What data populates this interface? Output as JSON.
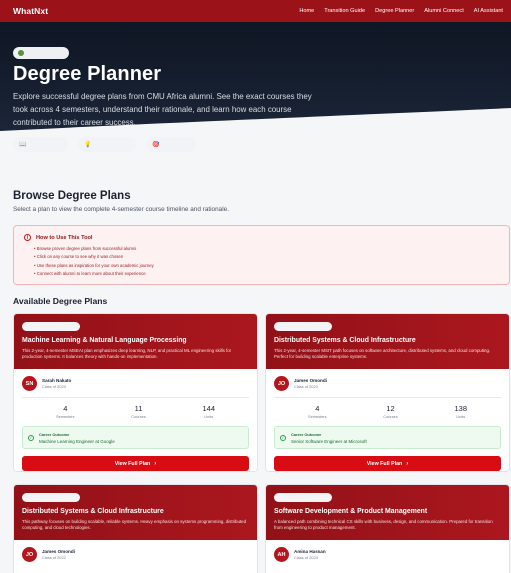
{
  "nav": {
    "brand": "WhatNxt",
    "links": [
      "Home",
      "Transition Guide",
      "Degree Planner",
      "Alumni Connect",
      "AI Assistant"
    ]
  },
  "hero": {
    "title": "Degree Planner",
    "description": "Explore successful degree plans from CMU Africa alumni. See the exact courses they took across 4 semesters, understand their rationale, and learn how each course contributed to their career success.",
    "chip_icons": [
      "📖",
      "💡",
      "🎯"
    ]
  },
  "browse": {
    "title": "Browse Degree Plans",
    "subtitle": "Select a plan to view the complete 4-semester course timeline and rationale."
  },
  "howto": {
    "title": "How to Use This Tool",
    "items": [
      "Browse proven degree plans from successful alumni",
      "Click on any course to see why it was chosen",
      "Use these plans as inspiration for your own academic journey",
      "Connect with alumni to learn more about their experience"
    ]
  },
  "available_title": "Available Degree Plans",
  "cards": [
    {
      "title": "Machine Learning & Natural Language Processing",
      "description": "This 2-year, 4-semester MSEAI plan emphasizes deep learning, NLP, and practical ML engineering skills for production systems. It balances theory with hands-on implementation.",
      "initials": "SN",
      "name": "Sarah Nakato",
      "class": "Class of 2023",
      "semesters": "4",
      "semesters_label": "Semesters",
      "courses": "11",
      "courses_label": "Courses",
      "units": "144",
      "units_label": "Units",
      "outcome_label": "Career Outcome",
      "outcome": "Machine Learning Engineer at Google",
      "cta": "View Full Plan"
    },
    {
      "title": "Distributed Systems & Cloud Infrastructure",
      "description": "This 2-year, 4-semester MSIT path focuses on software architecture, distributed systems, and cloud computing. Perfect for building scalable enterprise systems.",
      "initials": "JO",
      "name": "James Omondi",
      "class": "Class of 2023",
      "semesters": "4",
      "semesters_label": "Semesters",
      "courses": "12",
      "courses_label": "Courses",
      "units": "138",
      "units_label": "Units",
      "outcome_label": "Career Outcome",
      "outcome": "Senior Software Engineer at Microsoft",
      "cta": "View Full Plan"
    },
    {
      "title": "Distributed Systems & Cloud Infrastructure",
      "description": "This pathway focuses on building scalable, reliable systems. Heavy emphasis on systems programming, distributed computing, and cloud technologies.",
      "initials": "JO",
      "name": "James Omondi",
      "class": "Class of 2022"
    },
    {
      "title": "Software Development & Product Management",
      "description": "A balanced path combining technical CS skills with business, design, and communication. Prepared for transition from engineering to product management.",
      "initials": "AH",
      "name": "Amina Hassan",
      "class": "Class of 2024"
    }
  ]
}
